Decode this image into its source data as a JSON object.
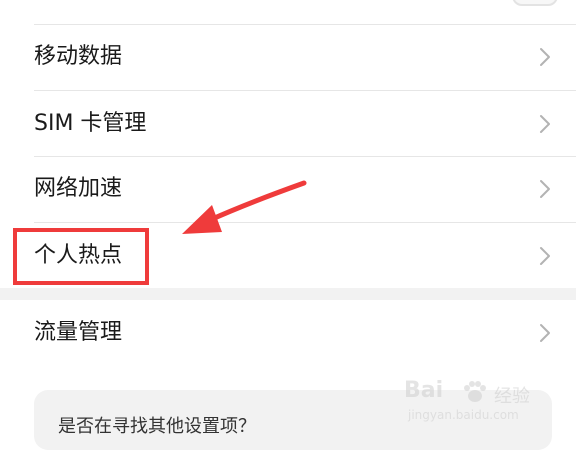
{
  "settings_list": {
    "items": [
      {
        "label": "移动数据"
      },
      {
        "label": "SIM 卡管理"
      },
      {
        "label": "网络加速"
      },
      {
        "label": "个人热点"
      },
      {
        "label": "流量管理"
      }
    ]
  },
  "suggestion": {
    "text": "是否在寻找其他设置项？"
  },
  "watermark": {
    "brand": "Bai",
    "sub": "经验",
    "url": "jingyan.baidu.com"
  },
  "icons": {
    "chevron": "chevron-right-icon",
    "annotation_arrow": "arrow-icon"
  },
  "colors": {
    "annotation": "#ef3b3b",
    "chevron": "#b3b3b3",
    "divider": "#e6e6e6",
    "section_gap": "#f2f2f2"
  }
}
